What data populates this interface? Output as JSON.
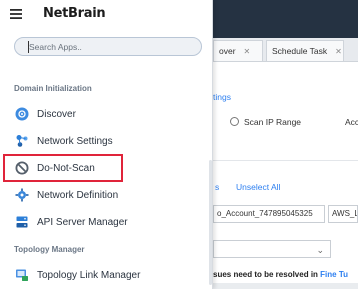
{
  "brand": "NetBrain",
  "search": {
    "placeholder": "Search Apps.."
  },
  "sections": {
    "domain": "Domain Initialization",
    "topology": "Topology Manager"
  },
  "items": {
    "discover": "Discover",
    "network_settings": "Network Settings",
    "do_not_scan": "Do-Not-Scan",
    "network_definition": "Network Definition",
    "api_server_manager": "API Server Manager",
    "topology_link_manager": "Topology Link Manager"
  },
  "icons": {
    "menu": "hamburger-menu-icon",
    "discover": "discover-icon",
    "network_settings": "network-settings-icon",
    "do_not_scan": "prohibited-icon",
    "network_definition": "network-definition-icon",
    "api_server_manager": "api-server-icon",
    "topology_link_manager": "topology-link-icon"
  },
  "background": {
    "tabs": [
      "over",
      "Schedule Task"
    ],
    "settings_link": "tings",
    "radio_label": "Scan IP Range",
    "radio_label_cut": "Acc",
    "unselect_all": "Unselect All",
    "s_fragment": "s",
    "account_value": "o_Account_747895045325",
    "aws_value": "AWS_La",
    "warning_text": "sues need to be resolved in",
    "warning_link": "Fine Tu"
  },
  "colors": {
    "highlight": "#e0243a",
    "topbar": "#253242",
    "link": "#2d7ff0"
  }
}
